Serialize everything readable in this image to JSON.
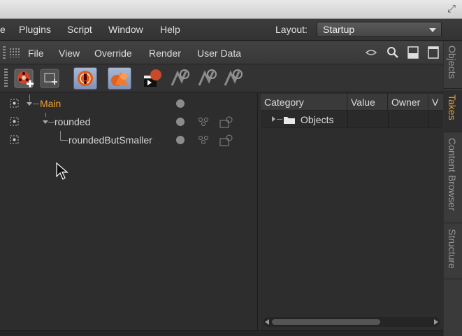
{
  "main_menu": {
    "items": [
      "e",
      "Plugins",
      "Script",
      "Window",
      "Help"
    ],
    "layout_label": "Layout:",
    "layout_value": "Startup"
  },
  "panel_menu": {
    "items": [
      "File",
      "View",
      "Override",
      "Render",
      "User Data"
    ]
  },
  "takes": [
    {
      "label": "Main",
      "color": "#f0a030"
    },
    {
      "label": "rounded",
      "color": "#d6d6d6"
    },
    {
      "label": "roundedButSmaller",
      "color": "#d6d6d6"
    }
  ],
  "overrides": {
    "columns": [
      "Category",
      "Value",
      "Owner",
      "V"
    ],
    "rows": [
      {
        "category": "Objects"
      }
    ]
  },
  "side_tabs": [
    "Objects",
    "Takes",
    "Content Browser",
    "Structure"
  ],
  "colors": {
    "accent": "#f0a030",
    "active_button": "#8fa2c4"
  }
}
